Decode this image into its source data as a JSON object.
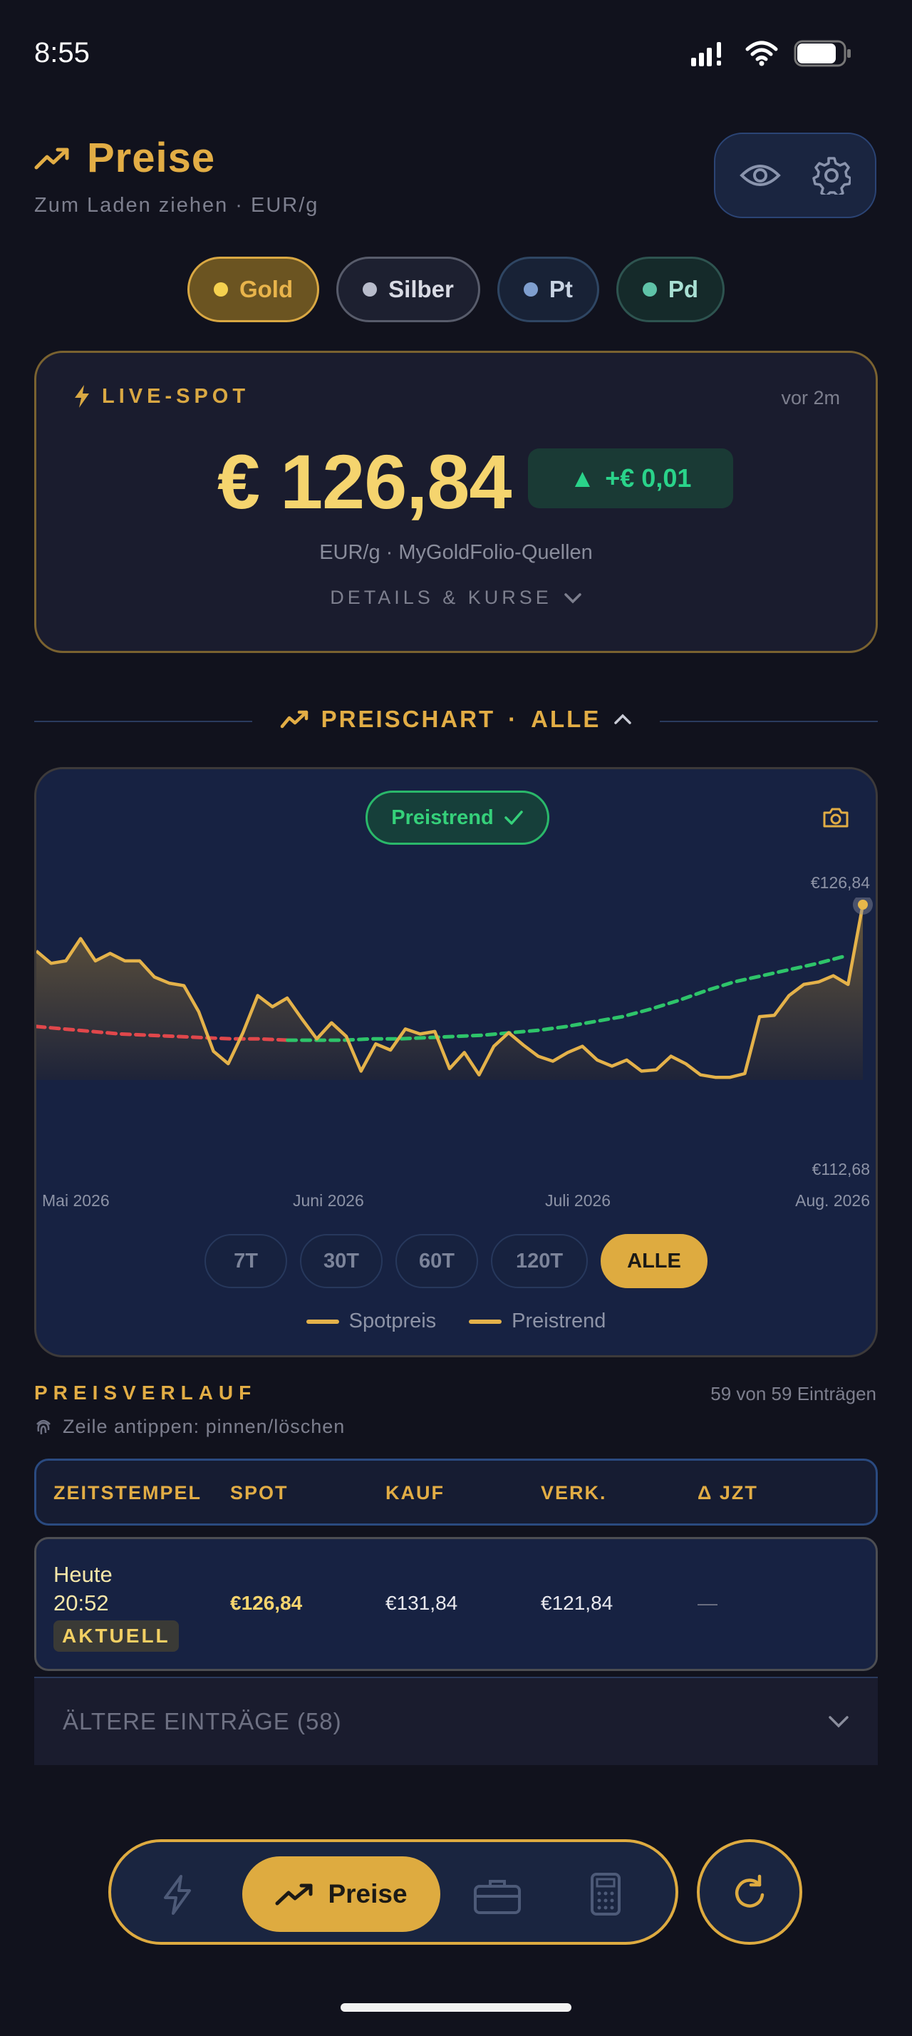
{
  "status_bar": {
    "time": "8:55"
  },
  "header": {
    "title": "Preise",
    "subtitle": "Zum Laden ziehen · EUR/g",
    "icons": [
      "trend-up-icon",
      "eye-icon",
      "gear-icon"
    ]
  },
  "metals": [
    {
      "label": "Gold",
      "dot": "#f5d14f",
      "selected": true
    },
    {
      "label": "Silber",
      "dot": "#b8bccb",
      "selected": false
    },
    {
      "label": "Pt",
      "dot": "#7f9fcf",
      "selected": false
    },
    {
      "label": "Pd",
      "dot": "#5fc3a8",
      "selected": false
    }
  ],
  "live_spot": {
    "label": "LIVE-SPOT",
    "age": "vor 2m",
    "price": "€ 126,84",
    "change": "+€ 0,01",
    "change_arrow": "▲",
    "source": "EUR/g · MyGoldFolio-Quellen",
    "details_label": "DETAILS & KURSE"
  },
  "chart_section": {
    "title": "PREISCHART",
    "range": "ALLE",
    "separator": "·"
  },
  "chart": {
    "trend_label": "Preistrend",
    "max_label": "€126,84",
    "min_label": "€112,68",
    "x_labels": [
      "Mai 2026",
      "Juni 2026",
      "Juli 2026",
      "Aug. 2026"
    ],
    "ranges": [
      "7T",
      "30T",
      "60T",
      "120T",
      "ALLE"
    ],
    "active_range": "ALLE",
    "legend": [
      "Spotpreis",
      "Preistrend"
    ]
  },
  "chart_data": {
    "type": "line",
    "ylim": [
      112.68,
      126.84
    ],
    "x_labels": [
      "Mai 2026",
      "Juni 2026",
      "Juli 2026",
      "Aug. 2026"
    ],
    "series": [
      {
        "name": "Spotpreis",
        "color": "#e4b24a",
        "values": [
          123.1,
          122.1,
          122.3,
          124.1,
          122.3,
          122.9,
          122.3,
          122.3,
          121.0,
          120.5,
          120.3,
          118.2,
          115.0,
          114.0,
          116.5,
          119.5,
          118.6,
          119.3,
          117.6,
          116.0,
          117.3,
          116.2,
          113.4,
          115.6,
          115.1,
          116.8,
          116.4,
          116.6,
          113.6,
          114.9,
          113.1,
          115.4,
          116.5,
          115.5,
          114.6,
          114.2,
          114.9,
          115.4,
          114.3,
          113.8,
          114.3,
          113.4,
          113.5,
          114.6,
          114.0,
          113.1,
          112.9,
          112.9,
          113.2,
          117.8,
          117.9,
          119.5,
          120.4,
          120.6,
          121.1,
          120.4,
          126.84
        ]
      },
      {
        "name": "Preistrend",
        "color": "#2ec46a",
        "down_color": "#e0474b",
        "values": [
          117.0,
          116.8,
          116.6,
          116.4,
          116.3,
          116.2,
          116.1,
          116.0,
          116.0,
          115.9,
          115.9,
          115.9,
          116.0,
          116.0,
          116.1,
          116.2,
          116.3,
          116.5,
          116.7,
          117.0,
          117.4,
          117.8,
          118.4,
          119.1,
          119.9,
          120.6,
          121.1,
          121.6,
          122.1,
          122.7
        ]
      }
    ]
  },
  "history": {
    "title": "PREISVERLAUF",
    "count": "59 von 59 Einträgen",
    "hint": "Zeile antippen: pinnen/löschen",
    "columns": [
      "ZEITSTEMPEL",
      "SPOT",
      "KAUF",
      "VERK.",
      "Δ JZT"
    ],
    "rows": [
      {
        "day": "Heute",
        "time": "20:52",
        "badge": "AKTUELL",
        "spot": "€126,84",
        "buy": "€131,84",
        "sell": "€121,84",
        "delta": "—"
      }
    ],
    "older_label": "ÄLTERE EINTRÄGE (58)"
  },
  "bottom_nav": {
    "active_label": "Preise",
    "items": [
      "flash-icon",
      "trend-up-icon",
      "briefcase-icon",
      "calculator-icon"
    ],
    "refresh": "refresh-icon"
  },
  "colors": {
    "accent": "#deab40",
    "price": "#f5d46e",
    "positive": "#2ad38a",
    "background": "#11121d"
  }
}
